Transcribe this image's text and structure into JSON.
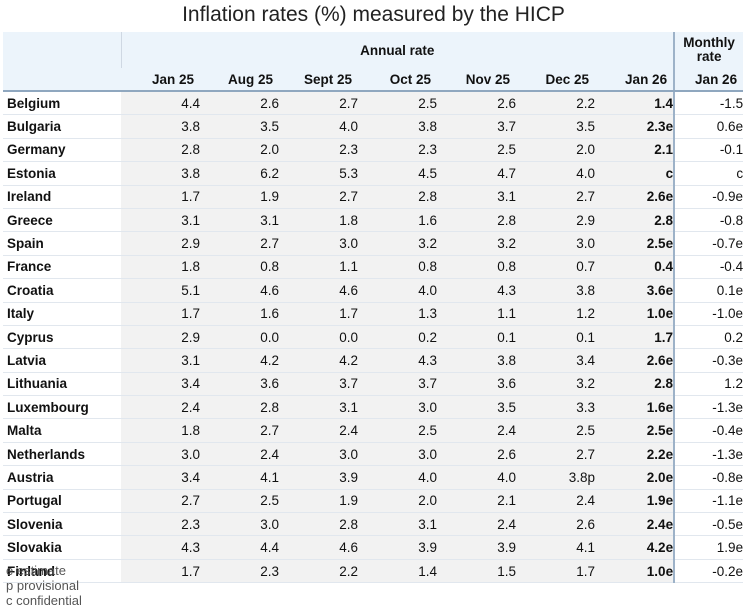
{
  "title": "Inflation rates (%) measured by the HICP",
  "header": {
    "annual_label": "Annual rate",
    "monthly_label_line1": "Monthly",
    "monthly_label_line2": "rate",
    "columns": [
      "Jan 25",
      "Aug 25",
      "Sept 25",
      "Oct 25",
      "Nov 25",
      "Dec 25",
      "Jan 26",
      "Jan 26"
    ]
  },
  "rows": [
    {
      "country": "Belgium",
      "values": [
        "4.4",
        "2.6",
        "2.7",
        "2.5",
        "2.6",
        "2.2",
        "1.4",
        "-1.5"
      ]
    },
    {
      "country": "Bulgaria",
      "values": [
        "3.8",
        "3.5",
        "4.0",
        "3.8",
        "3.7",
        "3.5",
        "2.3e",
        "0.6e"
      ]
    },
    {
      "country": "Germany",
      "values": [
        "2.8",
        "2.0",
        "2.3",
        "2.3",
        "2.5",
        "2.0",
        "2.1",
        "-0.1"
      ]
    },
    {
      "country": "Estonia",
      "values": [
        "3.8",
        "6.2",
        "5.3",
        "4.5",
        "4.7",
        "4.0",
        "c",
        "c"
      ]
    },
    {
      "country": "Ireland",
      "values": [
        "1.7",
        "1.9",
        "2.7",
        "2.8",
        "3.1",
        "2.7",
        "2.6e",
        "-0.9e"
      ]
    },
    {
      "country": "Greece",
      "values": [
        "3.1",
        "3.1",
        "1.8",
        "1.6",
        "2.8",
        "2.9",
        "2.8",
        "-0.8"
      ]
    },
    {
      "country": "Spain",
      "values": [
        "2.9",
        "2.7",
        "3.0",
        "3.2",
        "3.2",
        "3.0",
        "2.5e",
        "-0.7e"
      ]
    },
    {
      "country": "France",
      "values": [
        "1.8",
        "0.8",
        "1.1",
        "0.8",
        "0.8",
        "0.7",
        "0.4",
        "-0.4"
      ]
    },
    {
      "country": "Croatia",
      "values": [
        "5.1",
        "4.6",
        "4.6",
        "4.0",
        "4.3",
        "3.8",
        "3.6e",
        "0.1e"
      ]
    },
    {
      "country": "Italy",
      "values": [
        "1.7",
        "1.6",
        "1.7",
        "1.3",
        "1.1",
        "1.2",
        "1.0e",
        "-1.0e"
      ]
    },
    {
      "country": "Cyprus",
      "values": [
        "2.9",
        "0.0",
        "0.0",
        "0.2",
        "0.1",
        "0.1",
        "1.7",
        "0.2"
      ]
    },
    {
      "country": "Latvia",
      "values": [
        "3.1",
        "4.2",
        "4.2",
        "4.3",
        "3.8",
        "3.4",
        "2.6e",
        "-0.3e"
      ]
    },
    {
      "country": "Lithuania",
      "values": [
        "3.4",
        "3.6",
        "3.7",
        "3.7",
        "3.6",
        "3.2",
        "2.8",
        "1.2"
      ]
    },
    {
      "country": "Luxembourg",
      "values": [
        "2.4",
        "2.8",
        "3.1",
        "3.0",
        "3.5",
        "3.3",
        "1.6e",
        "-1.3e"
      ]
    },
    {
      "country": "Malta",
      "values": [
        "1.8",
        "2.7",
        "2.4",
        "2.5",
        "2.4",
        "2.5",
        "2.5e",
        "-0.4e"
      ]
    },
    {
      "country": "Netherlands",
      "values": [
        "3.0",
        "2.4",
        "3.0",
        "3.0",
        "2.6",
        "2.7",
        "2.2e",
        "-1.3e"
      ]
    },
    {
      "country": "Austria",
      "values": [
        "3.4",
        "4.1",
        "3.9",
        "4.0",
        "4.0",
        "3.8p",
        "2.0e",
        "-0.8e"
      ]
    },
    {
      "country": "Portugal",
      "values": [
        "2.7",
        "2.5",
        "1.9",
        "2.0",
        "2.1",
        "2.4",
        "1.9e",
        "-1.1e"
      ]
    },
    {
      "country": "Slovenia",
      "values": [
        "2.3",
        "3.0",
        "2.8",
        "3.1",
        "2.4",
        "2.6",
        "2.4e",
        "-0.5e"
      ]
    },
    {
      "country": "Slovakia",
      "values": [
        "4.3",
        "4.4",
        "4.6",
        "3.9",
        "3.9",
        "4.1",
        "4.2e",
        "1.9e"
      ]
    },
    {
      "country": "Finland",
      "values": [
        "1.7",
        "2.3",
        "2.2",
        "1.4",
        "1.5",
        "1.7",
        "1.0e",
        "-0.2e"
      ]
    }
  ],
  "legend": [
    "e estimate",
    "p provisional",
    "c confidential"
  ]
}
